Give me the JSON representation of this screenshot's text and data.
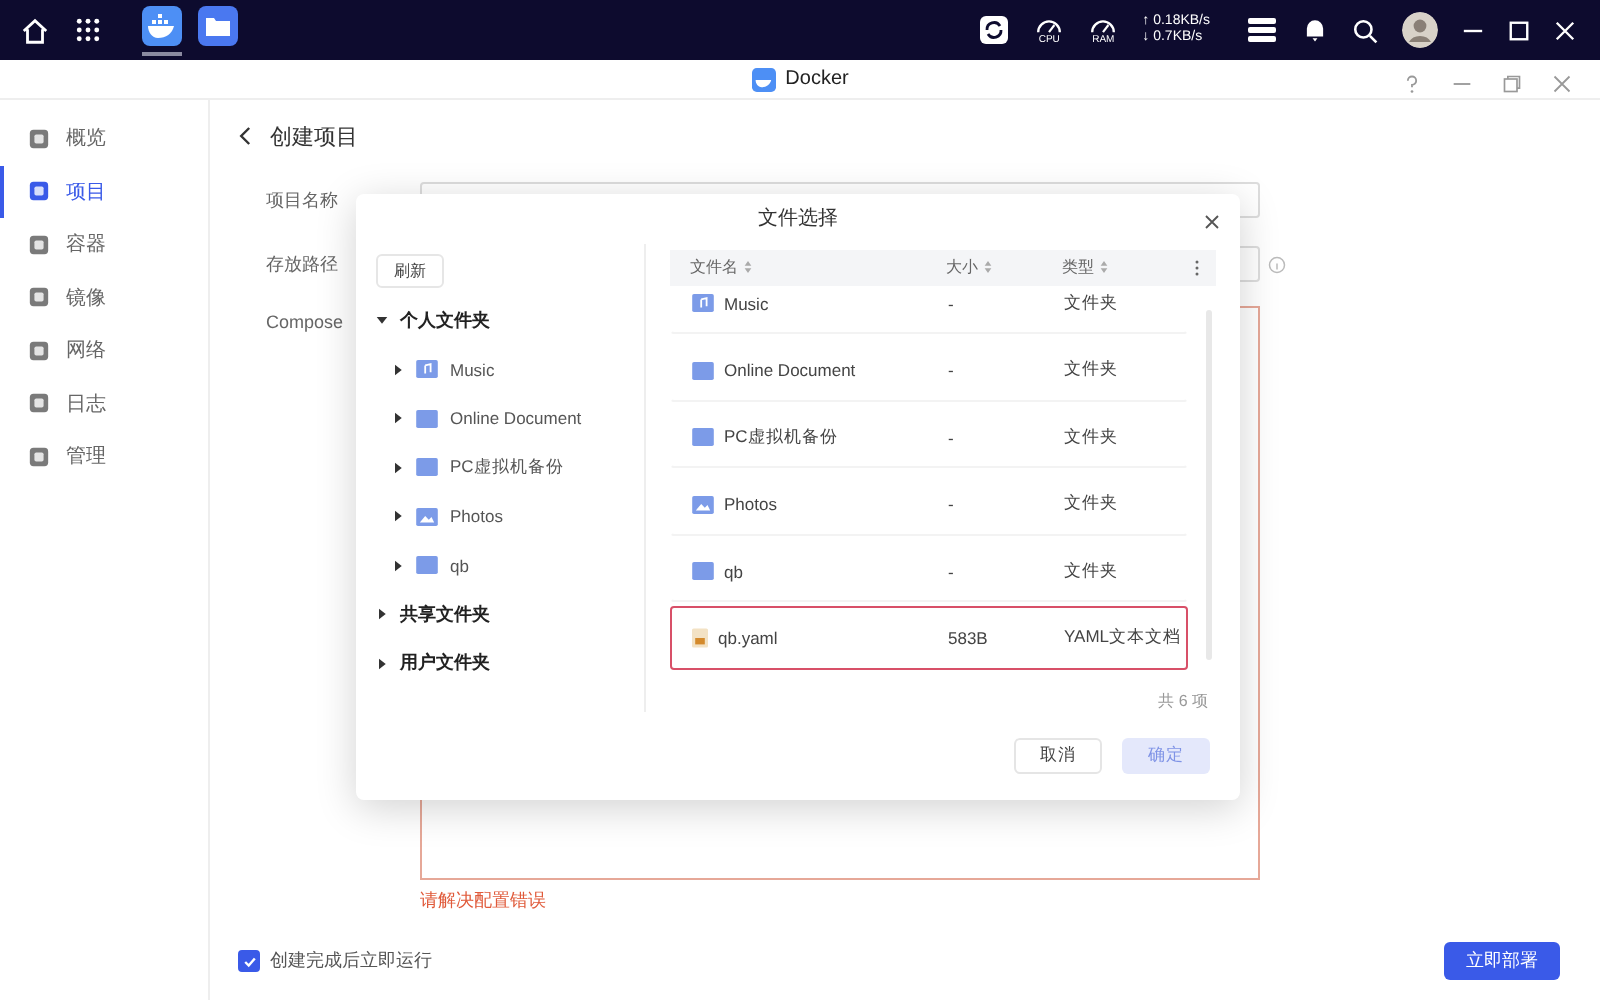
{
  "taskbar": {
    "net_up": "↑ 0.18KB/s",
    "net_down": "↓ 0.7KB/s",
    "cpu": "CPU",
    "ram": "RAM",
    "apps": [
      {
        "kind": "docker",
        "selected": true
      },
      {
        "kind": "files",
        "selected": false
      }
    ]
  },
  "window": {
    "title": "Docker"
  },
  "sidebar": {
    "items": [
      {
        "label": "概览",
        "selected": false
      },
      {
        "label": "项目",
        "selected": true
      },
      {
        "label": "容器",
        "selected": false
      },
      {
        "label": "镜像",
        "selected": false
      },
      {
        "label": "网络",
        "selected": false
      },
      {
        "label": "日志",
        "selected": false
      },
      {
        "label": "管理",
        "selected": false
      }
    ]
  },
  "page": {
    "title": "创建项目",
    "fields": [
      {
        "label": "项目名称"
      },
      {
        "label": "存放路径"
      },
      {
        "label": "Compose"
      }
    ],
    "error": "请解决配置错误",
    "run_after": {
      "label": "创建完成后立即运行",
      "checked": true
    },
    "deploy_button": "立即部署"
  },
  "dialog": {
    "title": "文件选择",
    "refresh": "刷新",
    "tree": [
      {
        "label": "个人文件夹",
        "expanded": true,
        "children": [
          {
            "label": "Music",
            "kind": "music",
            "expanded": false
          },
          {
            "label": "Online Document",
            "kind": "folder",
            "expanded": false
          },
          {
            "label": "PC虚拟机备份",
            "kind": "folder",
            "expanded": false
          },
          {
            "label": "Photos",
            "kind": "photos",
            "expanded": false
          },
          {
            "label": "qb",
            "kind": "folder",
            "expanded": false
          }
        ]
      },
      {
        "label": "共享文件夹",
        "expanded": false
      },
      {
        "label": "用户文件夹",
        "expanded": false
      }
    ],
    "columns": [
      "文件名",
      "大小",
      "类型"
    ],
    "rows": [
      {
        "name": "Music",
        "size": "-",
        "type": "文件夹",
        "kind": "music",
        "selected": false
      },
      {
        "name": "Online Document",
        "size": "-",
        "type": "文件夹",
        "kind": "folder",
        "selected": false
      },
      {
        "name": "PC虚拟机备份",
        "size": "-",
        "type": "文件夹",
        "kind": "folder",
        "selected": false
      },
      {
        "name": "Photos",
        "size": "-",
        "type": "文件夹",
        "kind": "photos",
        "selected": false
      },
      {
        "name": "qb",
        "size": "-",
        "type": "文件夹",
        "kind": "folder",
        "selected": false
      },
      {
        "name": "qb.yaml",
        "size": "583B",
        "type": "YAML文本文档",
        "kind": "file",
        "selected": true
      }
    ],
    "count": "共 6 项",
    "cancel": "取消",
    "confirm": {
      "label": "确定",
      "disabled": true
    }
  }
}
